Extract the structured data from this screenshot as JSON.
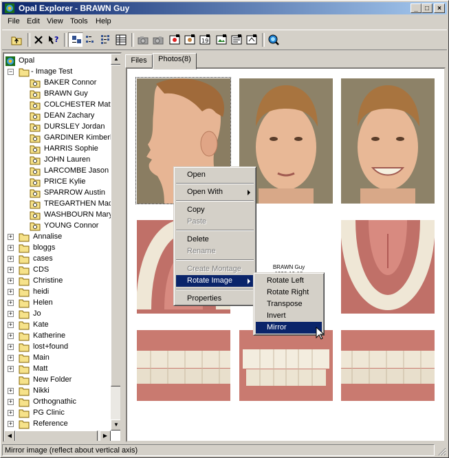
{
  "window": {
    "title": "Opal Explorer - BRAWN Guy",
    "minimize": "_",
    "maximize": "□",
    "close": "×"
  },
  "menu": [
    "File",
    "Edit",
    "View",
    "Tools",
    "Help"
  ],
  "toolbar": {
    "icons": [
      "up-folder-icon",
      "delete-icon",
      "properties-help-icon",
      "large-icons-view-icon",
      "small-icons-view-icon",
      "list-view-icon",
      "details-view-icon",
      "camera-icon",
      "camera-gray-icon",
      "capture-icon",
      "import-icon",
      "calendar-icon",
      "montage-icon",
      "print-icon",
      "export-icon",
      "search-icon"
    ]
  },
  "tree": {
    "root": "Opal",
    "expanded_folder": "- Image Test",
    "patients": [
      "BAKER Connor",
      "BRAWN Guy",
      "COLCHESTER Matth",
      "DEAN Zachary",
      "DURSLEY Jordan",
      "GARDINER Kimberly",
      "HARRIS Sophie",
      "JOHN Lauren",
      "LARCOMBE Jason",
      "PRICE Kylie",
      "SPARROW Austin",
      "TREGARTHEN Madis",
      "WASHBOURN Mary",
      "YOUNG Connor"
    ],
    "folders": [
      "Annalise",
      "bloggs",
      "cases",
      "CDS",
      "Christine",
      "heidi",
      "Helen",
      "Jo",
      "Kate",
      "Katherine",
      "lost+found",
      "Main",
      "Matt",
      "New Folder",
      "Nikki",
      "Orthognathic",
      "PG Clinic",
      "Reference"
    ]
  },
  "tabs": [
    {
      "label": "Files",
      "active": false
    },
    {
      "label": "Photos(8)",
      "active": true
    }
  ],
  "caption": {
    "name": "BRAWN Guy",
    "date": "1998-10-18"
  },
  "context_menu": {
    "items": [
      {
        "label": "Open",
        "disabled": false
      },
      {
        "label": "Open With",
        "disabled": false,
        "submenu": true
      },
      {
        "label": "Copy",
        "disabled": false
      },
      {
        "label": "Paste",
        "disabled": true
      },
      {
        "label": "Delete",
        "disabled": false
      },
      {
        "label": "Rename",
        "disabled": true
      },
      {
        "label": "Create Montage",
        "disabled": true
      },
      {
        "label": "Rotate Image",
        "disabled": false,
        "submenu": true,
        "highlighted": true
      },
      {
        "label": "Properties",
        "disabled": false
      }
    ]
  },
  "submenu": {
    "items": [
      "Rotate Left",
      "Rotate Right",
      "Transpose",
      "Invert",
      "Mirror"
    ],
    "highlighted": "Mirror"
  },
  "status": {
    "text": "Mirror image (reflect about vertical axis)"
  },
  "colors": {
    "title_start": "#0a246a",
    "title_end": "#a6caf0",
    "highlight": "#0a246a",
    "face": "#d4d0c8",
    "folder": "#f6e28a"
  }
}
